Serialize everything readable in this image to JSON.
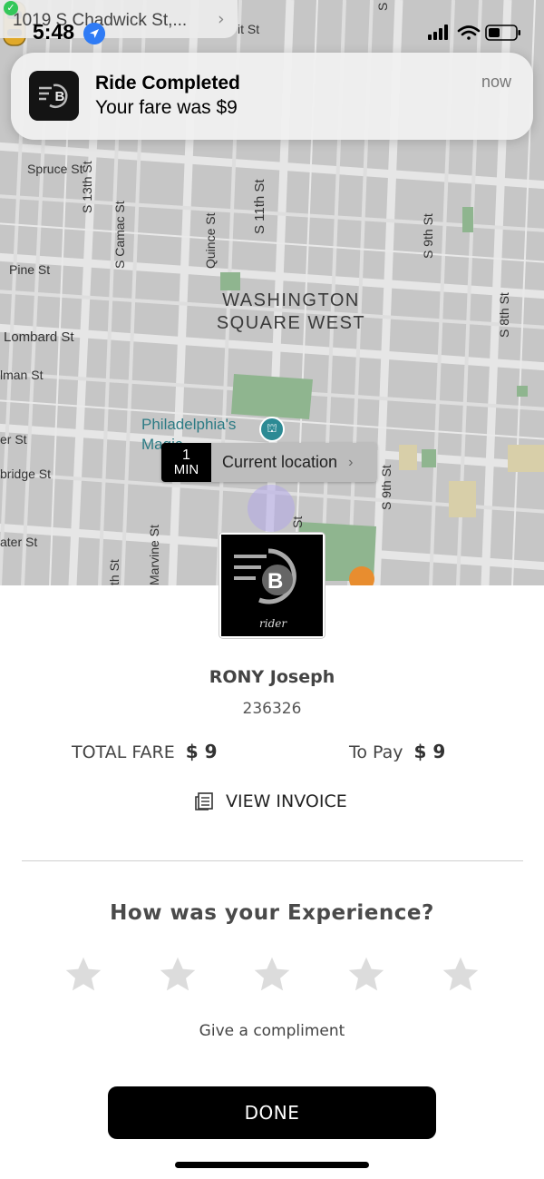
{
  "status_bar": {
    "back_app_label": "1019 S Chadwick St,...",
    "time": "5:48"
  },
  "notification": {
    "title": "Ride Completed",
    "body": "Your fare was $9",
    "time": "now"
  },
  "map": {
    "neighborhood_line1": "WASHINGTON",
    "neighborhood_line2": "SQUARE WEST",
    "poi_line1": "Philadelphia's",
    "poi_line2": "Magic",
    "streets": {
      "spruce": "Spruce St",
      "s13th": "S 13th St",
      "s_camac": "S Camac St",
      "quince": "Quince St",
      "s11th": "S 11th St",
      "s9th_top": "S 9th St",
      "s8th": "S 8th St",
      "pine": "Pine St",
      "lombard": "Lombard St",
      "waverly": "lman St",
      "south_er": "er St",
      "bainbridge": "bridge St",
      "fitzwater": "ater St",
      "th_st": "th St",
      "marvine": "Marvine St",
      "st_partial": "St",
      "s9th_bottom": "S 9th St",
      "top_it": "it St",
      "top_s": "S"
    },
    "eta_number": "1",
    "eta_unit": "MIN",
    "current_location_label": "Current location",
    "car_color": "#e0a92b"
  },
  "trip_summary": {
    "brand_tagline": "rider",
    "driver_name": "RONY Joseph",
    "driver_id": "236326",
    "total_fare_label": "TOTAL FARE",
    "total_fare_value": "$ 9",
    "to_pay_label": "To Pay",
    "to_pay_value": "$ 9",
    "view_invoice_label": "VIEW INVOICE"
  },
  "rating": {
    "question": "How was your Experience?",
    "stars_total": 5,
    "stars_selected": 0,
    "compliment_label": "Give a compliment"
  },
  "done_label": "DONE",
  "colors": {
    "map_bg": "#c9c9c9",
    "road": "#e4e4e4",
    "park": "#8fb58f",
    "star_empty": "#dcdcdc",
    "button": "#000000"
  }
}
